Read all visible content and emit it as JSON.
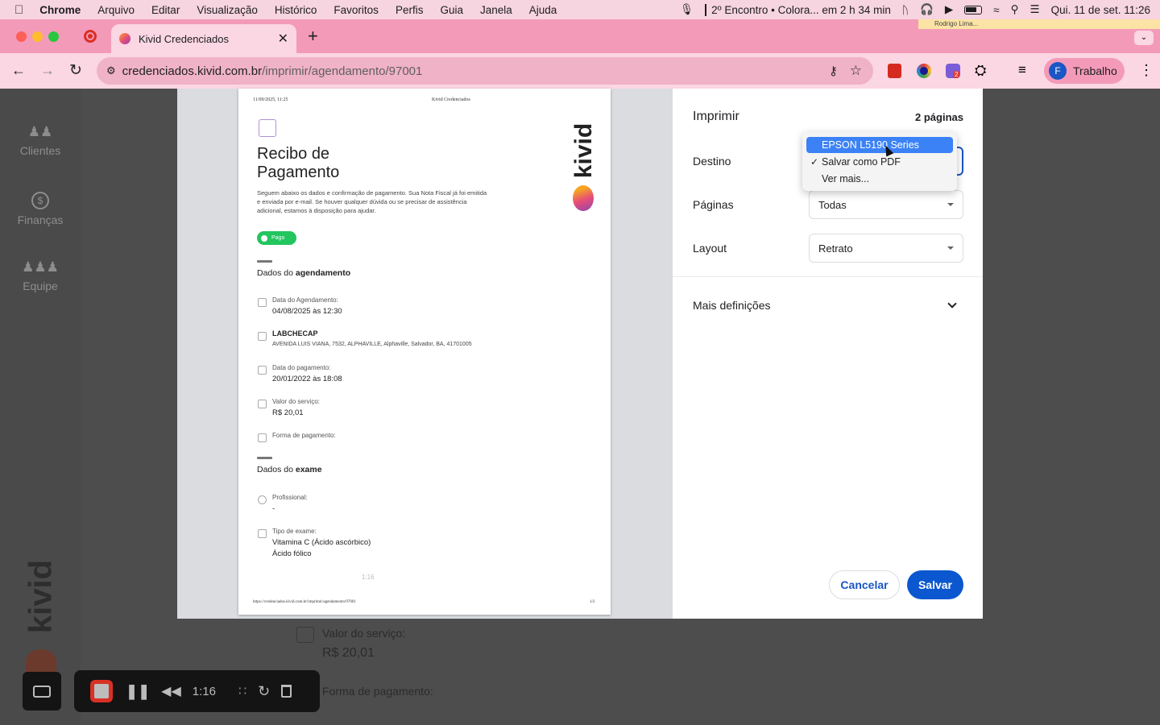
{
  "menubar": {
    "items": [
      "Chrome",
      "Arquivo",
      "Editar",
      "Visualização",
      "Histórico",
      "Favoritos",
      "Perfis",
      "Guia",
      "Janela",
      "Ajuda"
    ],
    "event": "2º Encontro • Colora... em 2 h 34 min",
    "datetime": "Qui. 11 de set.  11:26"
  },
  "browser": {
    "tab_title": "Kivid Credenciados",
    "url_host": "credenciados.kivid.com.br",
    "url_path": "/imprimir/agendamento/97001",
    "profile_initial": "F",
    "profile_label": "Trabalho",
    "account_hint": "Rodrigo Lima...",
    "extension_badge": "2"
  },
  "sidebar": {
    "items": [
      {
        "label": "Clientes",
        "icon": "users-icon"
      },
      {
        "label": "Finanças",
        "icon": "dollar-icon"
      },
      {
        "label": "Equipe",
        "icon": "team-icon"
      }
    ],
    "logo": "kivid"
  },
  "print": {
    "title": "Imprimir",
    "pages_count": "2 páginas",
    "destination_label": "Destino",
    "destination_options": [
      "EPSON L5190 Series",
      "Salvar como PDF",
      "Ver mais..."
    ],
    "selected_destination": "Salvar como PDF",
    "highlighted_option": "EPSON L5190 Series",
    "pages_label": "Páginas",
    "pages_value": "Todas",
    "layout_label": "Layout",
    "layout_value": "Retrato",
    "more_settings": "Mais definições",
    "cancel": "Cancelar",
    "save": "Salvar"
  },
  "document": {
    "header_date": "11/09/2025, 11:25",
    "header_title": "Kivid Credenciados",
    "title_line1": "Recibo de",
    "title_line2": "Pagamento",
    "intro": "Seguem abaixo os dados e confirmação de pagamento. Sua Nota Fiscal já foi emitida e enviada por e-mail. Se houver qualquer dúvida ou se precisar de assistência adicional, estamos à disposição para ajudar.",
    "status_badge": "Pago",
    "logo_text": "kivid",
    "section1_prefix": "Dados do ",
    "section1_bold": "agendamento",
    "fields": [
      {
        "label": "Data do Agendamento:",
        "value": "04/08/2025 às 12:30"
      },
      {
        "label": "LABCHECAP",
        "value": "AVENIDA LUIS VIANA, 7532, ALPHAVILLE, Alphaville, Salvador, BA, 41701005"
      },
      {
        "label": "Data do pagamento:",
        "value": "20/01/2022 às 18:08"
      },
      {
        "label": "Valor do serviço:",
        "value": "R$ 20,01"
      },
      {
        "label": "Forma de pagamento:",
        "value": ""
      }
    ],
    "section2_prefix": "Dados do ",
    "section2_bold": "exame",
    "exam_fields": [
      {
        "label": "Profissional:",
        "value": "-"
      },
      {
        "label": "Tipo de exame:",
        "value": "Vitamina C (Ácido ascórbico)",
        "value2": "Ácido fólico"
      }
    ],
    "footer_url": "https://credenciados.kivid.com.br/imprimir/agendamento/97001",
    "footer_page": "1/2",
    "timer_watermark": "1:16"
  },
  "background_page": {
    "service_label": "Valor do serviço:",
    "service_value": "R$ 20,01",
    "payment_label": "Forma de pagamento:"
  },
  "recorder": {
    "time": "1:16"
  }
}
